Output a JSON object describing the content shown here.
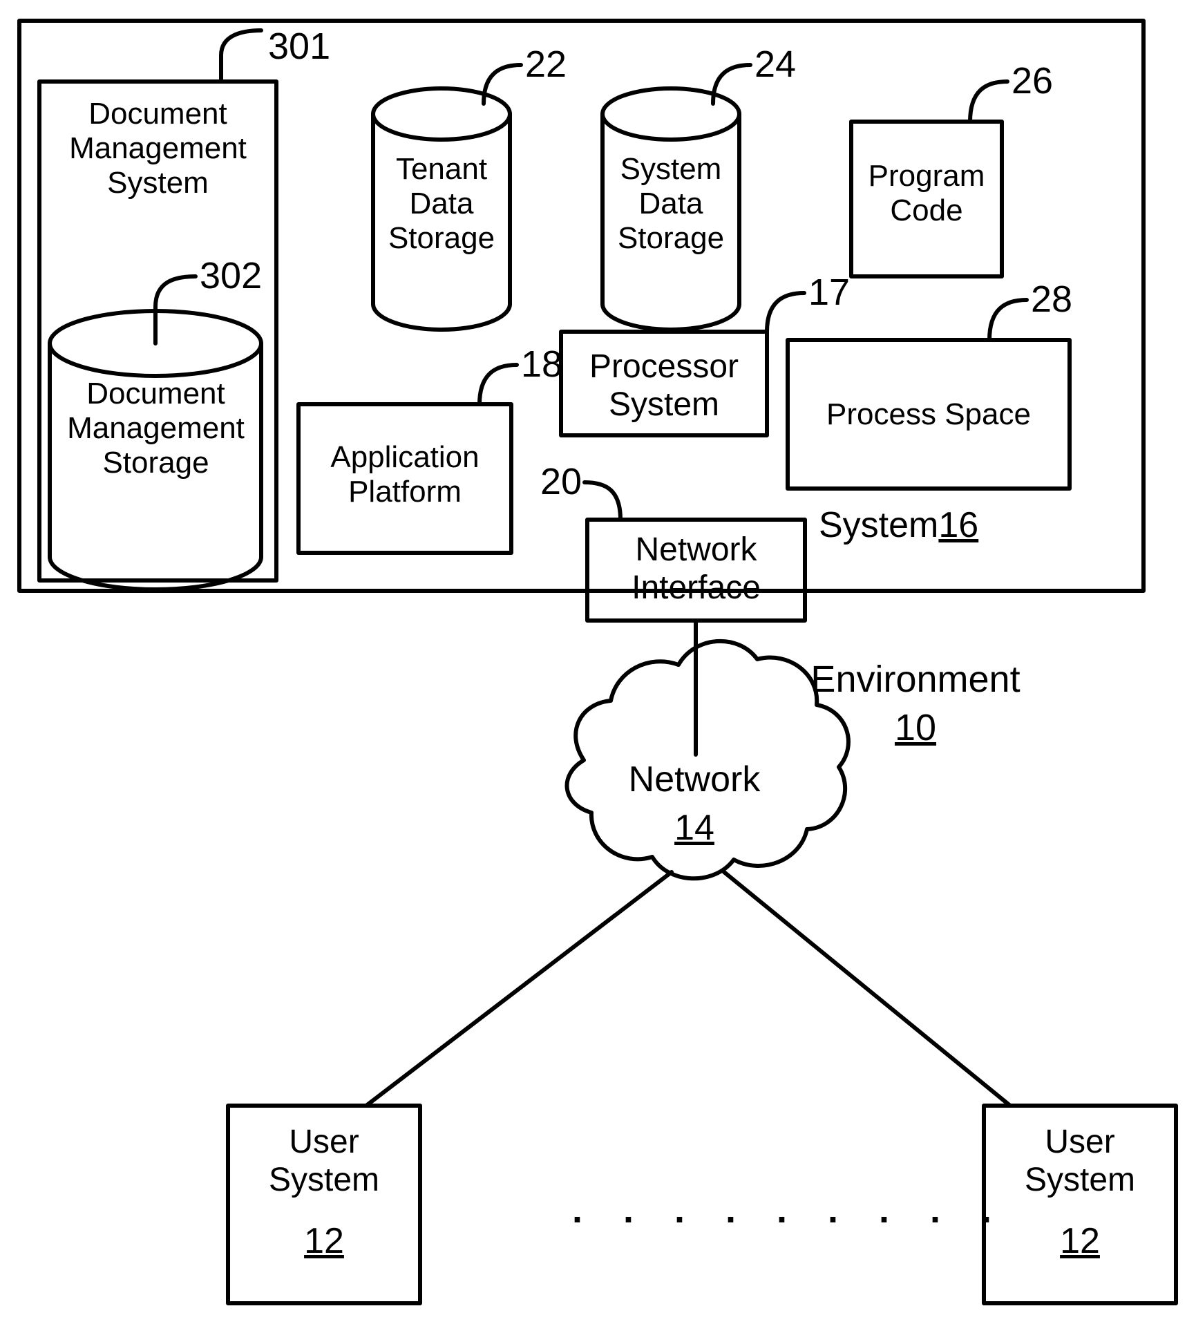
{
  "figure": {
    "type": "patent-system-architecture-diagram",
    "environment_label": "Environment",
    "environment_ref": "10"
  },
  "system_container": {
    "label_text": "System",
    "label_ref": "16"
  },
  "blocks": {
    "document_management_system": {
      "label": "Document\nManagement\nSystem",
      "ref": "301"
    },
    "document_management_storage": {
      "label": "Document\nManagement\nStorage",
      "ref": "302",
      "shape": "cylinder"
    },
    "tenant_data_storage": {
      "label": "Tenant\nData\nStorage",
      "ref": "22",
      "shape": "cylinder"
    },
    "system_data_storage": {
      "label": "System\nData\nStorage",
      "ref": "24",
      "shape": "cylinder"
    },
    "program_code": {
      "label": "Program\nCode",
      "ref": "26",
      "shape": "rectangle"
    },
    "process_space": {
      "label": "Process Space",
      "ref": "28",
      "shape": "rectangle"
    },
    "processor_system": {
      "label": "Processor\nSystem",
      "ref": "17",
      "shape": "rectangle"
    },
    "application_platform": {
      "label": "Application\nPlatform",
      "ref": "18",
      "shape": "rectangle"
    },
    "network_interface": {
      "label": "Network\nInterface",
      "ref": "20",
      "shape": "rectangle"
    },
    "network": {
      "label": "Network",
      "ref": "14",
      "shape": "cloud"
    },
    "user_system_left": {
      "label": "User\nSystem",
      "ref": "12",
      "shape": "rectangle"
    },
    "user_system_right": {
      "label": "User\nSystem",
      "ref": "12",
      "shape": "rectangle"
    },
    "ellipsis": {
      "label": ". . . . . . . . ."
    }
  },
  "colors": {
    "stroke": "#000000",
    "background": "#ffffff"
  }
}
